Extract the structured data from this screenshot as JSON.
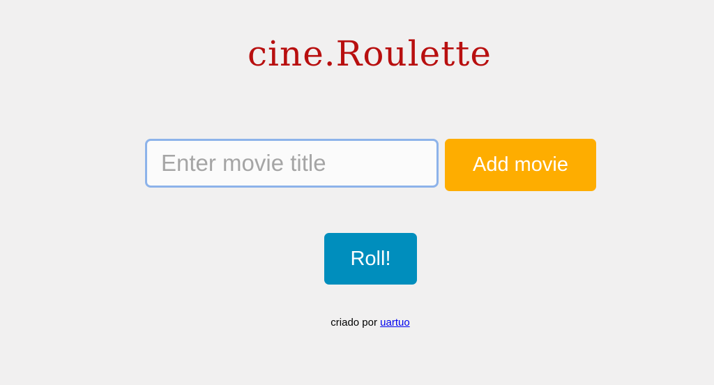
{
  "app": {
    "title": "cine.Roulette"
  },
  "form": {
    "movie_input_value": "",
    "movie_input_placeholder": "Enter movie title",
    "add_button_label": "Add movie"
  },
  "actions": {
    "roll_button_label": "Roll!"
  },
  "footer": {
    "credit_text": "criado por ",
    "author_link_text": "uartuo"
  },
  "colors": {
    "background": "#f1f0f0",
    "title": "#b80f0f",
    "add_button": "#fead00",
    "roll_button": "#008ebd",
    "input_border": "#8db3ea",
    "link": "#0000ee"
  }
}
